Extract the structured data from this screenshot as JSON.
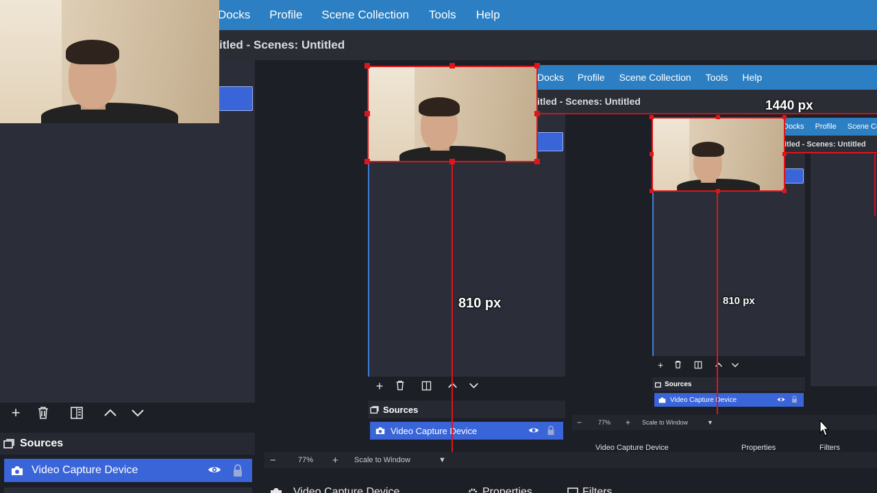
{
  "menu": [
    "Docks",
    "Profile",
    "Scene Collection",
    "Tools",
    "Help"
  ],
  "window_title": "itled - Scenes: Untitled",
  "sources": {
    "title": "Sources",
    "item": "Video Capture Device"
  },
  "zoom": {
    "minus": "−",
    "value": "77%",
    "plus": "+",
    "mode": "Scale to Window"
  },
  "bottom_bar": {
    "source": "Video Capture Device",
    "properties": "Properties",
    "filters": "Filters"
  },
  "measure": {
    "width_label": "1440 px",
    "height_label": "810 px"
  },
  "icons": {
    "add": "+",
    "up": "⌃",
    "down": "⌄",
    "dropdown": "▼"
  },
  "colors": {
    "menu_blue": "#2c7fc2",
    "selected_blue": "#3965d8",
    "selection_red": "#e0141b"
  }
}
